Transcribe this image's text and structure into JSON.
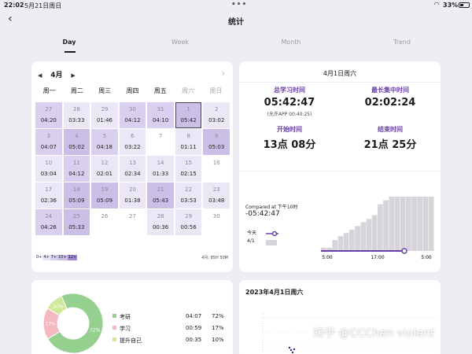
{
  "status": {
    "time": "22:02",
    "date": "5月21日周日",
    "battery": "33%"
  },
  "header": {
    "title": "统计",
    "back_icon": "chevron-left-icon"
  },
  "tabs": [
    {
      "label": "Day",
      "active": true
    },
    {
      "label": "Week",
      "active": false
    },
    {
      "label": "Month",
      "active": false
    },
    {
      "label": "Trend",
      "active": false
    }
  ],
  "calendar": {
    "month": "4月",
    "prev_icon": "triangle-left-icon",
    "next_icon": "triangle-right-icon",
    "weekdays": [
      "周一",
      "周二",
      "周三",
      "周四",
      "周五",
      "周六",
      "周日"
    ],
    "colors": {
      "level1": "#ebe7f6",
      "level2": "#d8d0ee",
      "level3": "#cbbfe8"
    },
    "cells": [
      {
        "day": "27",
        "time": "04:20",
        "level": 2
      },
      {
        "day": "28",
        "time": "03:33",
        "level": 1
      },
      {
        "day": "29",
        "time": "01:46",
        "level": 1
      },
      {
        "day": "30",
        "time": "04:12",
        "level": 2
      },
      {
        "day": "31",
        "time": "04:10",
        "level": 2
      },
      {
        "day": "1",
        "time": "05:42",
        "level": 3,
        "today": true
      },
      {
        "day": "2",
        "time": "03:02",
        "level": 1
      },
      {
        "day": "3",
        "time": "04:07",
        "level": 2
      },
      {
        "day": "4",
        "time": "05:02",
        "level": 3
      },
      {
        "day": "5",
        "time": "04:18",
        "level": 2
      },
      {
        "day": "6",
        "time": "03:22",
        "level": 1
      },
      {
        "day": "7",
        "time": "",
        "level": 0
      },
      {
        "day": "8",
        "time": "01:11",
        "level": 1
      },
      {
        "day": "9",
        "time": "05:03",
        "level": 3
      },
      {
        "day": "10",
        "time": "03:04",
        "level": 1
      },
      {
        "day": "11",
        "time": "04:12",
        "level": 2
      },
      {
        "day": "12",
        "time": "02:01",
        "level": 1
      },
      {
        "day": "13",
        "time": "02:34",
        "level": 1
      },
      {
        "day": "14",
        "time": "01:33",
        "level": 1
      },
      {
        "day": "15",
        "time": "02:15",
        "level": 1
      },
      {
        "day": "16",
        "time": "",
        "level": 0
      },
      {
        "day": "17",
        "time": "02:36",
        "level": 1
      },
      {
        "day": "18",
        "time": "05:09",
        "level": 3
      },
      {
        "day": "19",
        "time": "05:09",
        "level": 3
      },
      {
        "day": "20",
        "time": "01:38",
        "level": 1
      },
      {
        "day": "21",
        "time": "05:43",
        "level": 3
      },
      {
        "day": "22",
        "time": "03:53",
        "level": 1
      },
      {
        "day": "23",
        "time": "03:48",
        "level": 1
      },
      {
        "day": "24",
        "time": "04:26",
        "level": 2
      },
      {
        "day": "25",
        "time": "05:33",
        "level": 3
      },
      {
        "day": "26",
        "time": "",
        "level": 0
      },
      {
        "day": "27",
        "time": "",
        "level": 0
      },
      {
        "day": "28",
        "time": "00:36",
        "level": 1
      },
      {
        "day": "29",
        "time": "00:56",
        "level": 1
      },
      {
        "day": "30",
        "time": "",
        "level": 0
      }
    ],
    "legend": [
      "0+",
      "4+",
      "7+",
      "10+",
      "12+"
    ],
    "month_total": "4月: 85H 50M"
  },
  "summary": {
    "date": "4月1日周六",
    "total_label": "总学习时间",
    "total_value": "05:42:47",
    "total_sub": "(允许APP 00:40:25)",
    "max_label": "最长集中时间",
    "max_value": "02:02:24",
    "start_label": "开始时间",
    "start_value": "13点 08分",
    "end_label": "结束时间",
    "end_value": "21点 25分",
    "compare_label": "Compared at 下午10时",
    "compare_value": "-05:42:47",
    "today_label": "今天",
    "date_label": "4/1",
    "x_ticks": [
      "5:00",
      "17:00",
      "5:00"
    ],
    "colors": {
      "accent": "#6a3fa8",
      "bar": "#d6d4da"
    }
  },
  "chart_data": {
    "type": "bar",
    "title": "",
    "xlabel": "",
    "ylabel": "",
    "x_ticks": [
      "5:00",
      "17:00",
      "5:00"
    ],
    "series": [
      {
        "name": "今天",
        "values": [
          0.06,
          0.06,
          0.2,
          0.27,
          0.33,
          0.39,
          0.46,
          0.53,
          0.59,
          0.66,
          0.86,
          0.93,
          1.0,
          1.0,
          1.0,
          1.0,
          1.0,
          1.0,
          1.0,
          1.0
        ]
      }
    ]
  },
  "breakdown": {
    "items": [
      {
        "name": "考研",
        "duration": "04:07",
        "pct": "72%",
        "value": 72,
        "color": "#95d08e"
      },
      {
        "name": "学习",
        "duration": "00:59",
        "pct": "17%",
        "value": 17,
        "color": "#f4b8c0"
      },
      {
        "name": "提升自己",
        "duration": "00:35",
        "pct": "10%",
        "value": 10,
        "color": "#cfe89a"
      }
    ]
  },
  "scatter": {
    "title": "2023年4月1日周六"
  },
  "watermark": "知乎 @CCChen violent"
}
